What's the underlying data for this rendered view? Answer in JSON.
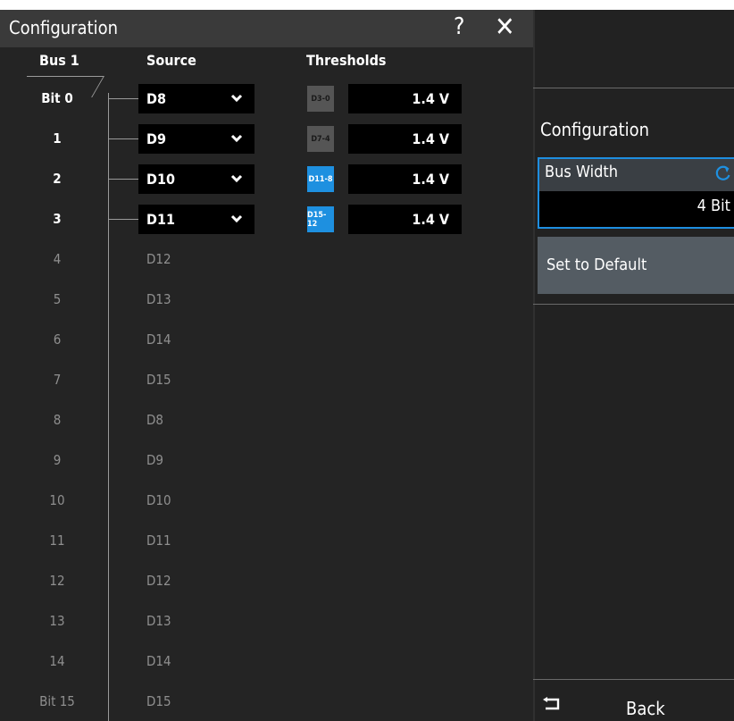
{
  "dialog": {
    "title": "Configuration",
    "help_glyph": "?",
    "close_glyph": "✕",
    "columns": {
      "bus": "Bus 1",
      "source": "Source",
      "thresholds": "Thresholds"
    }
  },
  "bits": [
    {
      "label": "Bit 0",
      "source": "D8",
      "active": true
    },
    {
      "label": "1",
      "source": "D9",
      "active": true
    },
    {
      "label": "2",
      "source": "D10",
      "active": true
    },
    {
      "label": "3",
      "source": "D11",
      "active": true
    },
    {
      "label": "4",
      "source": "D12",
      "active": false
    },
    {
      "label": "5",
      "source": "D13",
      "active": false
    },
    {
      "label": "6",
      "source": "D14",
      "active": false
    },
    {
      "label": "7",
      "source": "D15",
      "active": false
    },
    {
      "label": "8",
      "source": "D8",
      "active": false
    },
    {
      "label": "9",
      "source": "D9",
      "active": false
    },
    {
      "label": "10",
      "source": "D10",
      "active": false
    },
    {
      "label": "11",
      "source": "D11",
      "active": false
    },
    {
      "label": "12",
      "source": "D12",
      "active": false
    },
    {
      "label": "13",
      "source": "D13",
      "active": false
    },
    {
      "label": "14",
      "source": "D14",
      "active": false
    },
    {
      "label": "Bit 15",
      "source": "D15",
      "active": false
    }
  ],
  "thresholds": [
    {
      "group": "D3-0",
      "value": "1.4 V",
      "color": "#555555"
    },
    {
      "group": "D7-4",
      "value": "1.4 V",
      "color": "#555555"
    },
    {
      "group": "D11-8",
      "value": "1.4 V",
      "color": "#1e90e0"
    },
    {
      "group": "D15-12",
      "value": "1.4 V",
      "color": "#1e90e0"
    }
  ],
  "panel": {
    "title": "Configuration",
    "bus_width_label": "Bus Width",
    "bus_width_value": "4 Bit",
    "default_label": "Set to Default",
    "back_label": "Back"
  },
  "icons": {
    "help": "question-icon",
    "close": "close-icon",
    "dropdown": "chevron-down-icon",
    "refresh": "refresh-icon",
    "back": "back-arrow-icon"
  }
}
